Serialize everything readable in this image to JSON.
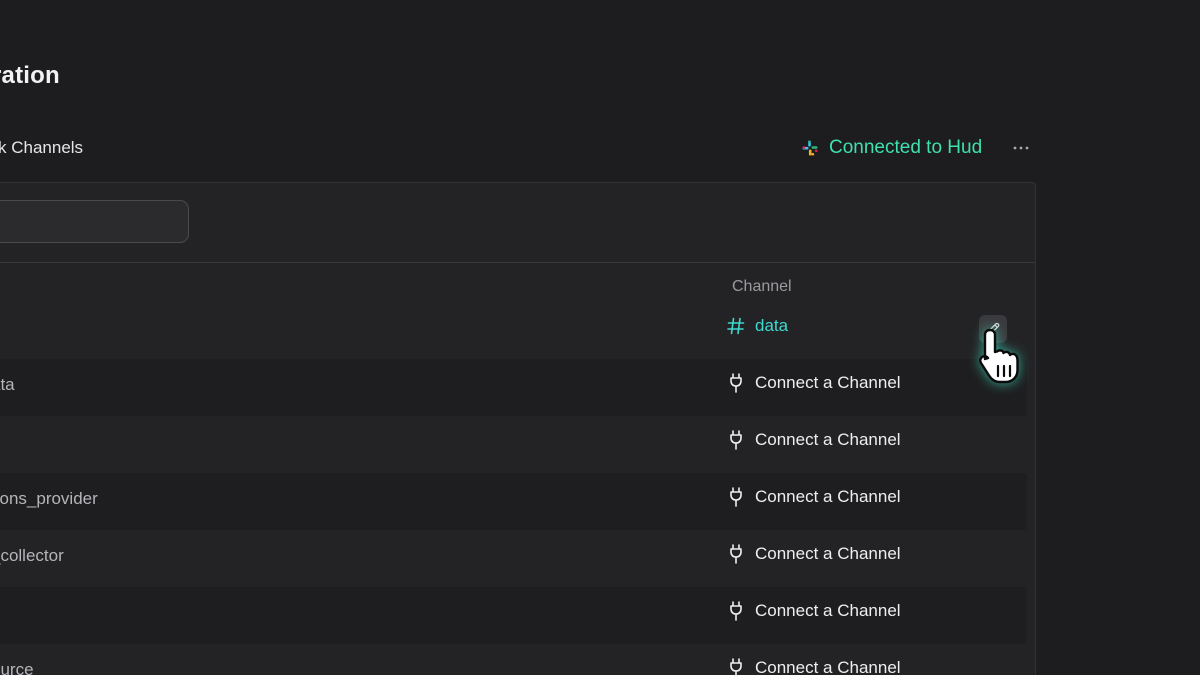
{
  "page": {
    "title": "ration",
    "section_label": "k Channels"
  },
  "status": {
    "text": "Connected to Hud",
    "icon": "slack-icon",
    "color": "#3ee0ad"
  },
  "more_button": {
    "label": "···",
    "icon": "more-horizontal-icon"
  },
  "search": {
    "value": "."
  },
  "table": {
    "column_header": "Channel",
    "rows": [
      {
        "name": "",
        "channel": "data",
        "connected": true
      },
      {
        "name": "ata",
        "channel": "Connect a Channel",
        "connected": false
      },
      {
        "name": "",
        "channel": "Connect a Channel",
        "connected": false
      },
      {
        "name": "tions_provider",
        "channel": "Connect a Channel",
        "connected": false
      },
      {
        "name": "_collector",
        "channel": "Connect a Channel",
        "connected": false
      },
      {
        "name": "",
        "channel": "Connect a Channel",
        "connected": false
      },
      {
        "name": "ource",
        "channel": "Connect a Channel",
        "connected": false
      }
    ]
  },
  "colors": {
    "background": "#1d1d1f",
    "panel": "#232325",
    "accent_green": "#3ee0ad",
    "accent_teal": "#3ed8cf"
  }
}
